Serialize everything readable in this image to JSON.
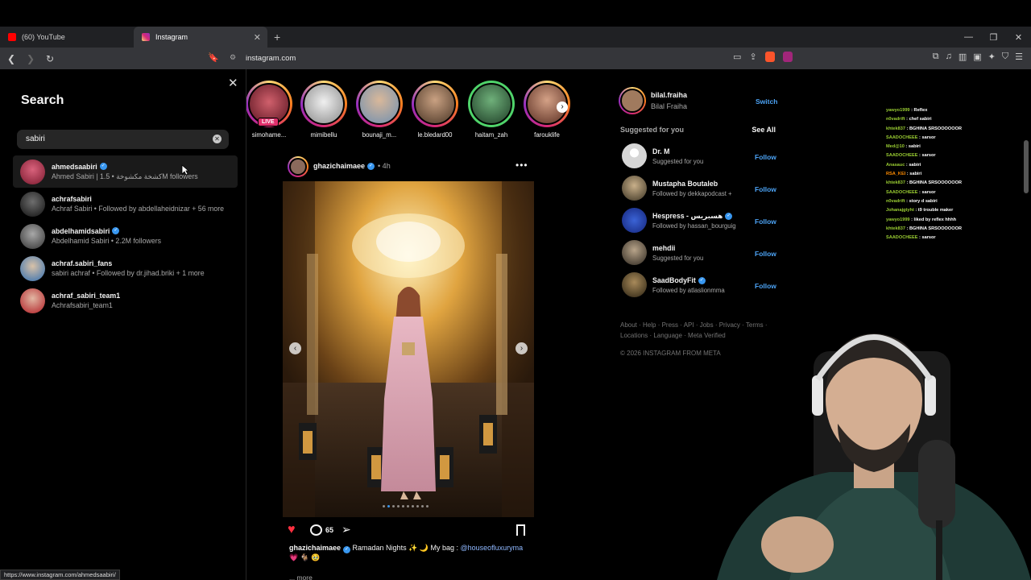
{
  "browser": {
    "tabs": [
      {
        "label": "(60) YouTube",
        "color": "#ff0000",
        "active": false
      },
      {
        "label": "Instagram",
        "color": "#d62976",
        "active": true
      }
    ],
    "url": "instagram.com",
    "status_url": "https://www.instagram.com/ahmedsaabiri/"
  },
  "search": {
    "title": "Search",
    "query": "sabiri",
    "results": [
      {
        "username": "ahmedsaabiri",
        "verified": true,
        "sub": "Ahmed Sabiri | 1.5 • كشخة مكشوخةM followers",
        "avatar_color": "#b2334b"
      },
      {
        "username": "achrafsabiri",
        "verified": false,
        "sub": "Achraf Sabiri • Followed by abdellaheidnizar + 56 more",
        "avatar_color": "#2b2b2b"
      },
      {
        "username": "abdelhamidsabiri",
        "verified": true,
        "sub": "Abdelhamid Sabiri • 2.2M followers",
        "avatar_color": "#5e5e5e"
      },
      {
        "username": "achraf.sabiri_fans",
        "verified": false,
        "sub": "sabiri achraf • Followed by dr.jihad.briki + 1 more",
        "avatar_color": "#3a7bbf"
      },
      {
        "username": "achraf_sabiri_team1",
        "verified": false,
        "sub": "Achrafsabiri_team1",
        "avatar_color": "#b01c24"
      }
    ]
  },
  "stories": [
    {
      "name": "simohame...",
      "live": true,
      "live_label": "LIVE",
      "color": "#9c2431",
      "ring": "gradient"
    },
    {
      "name": "mimibellu",
      "live": false,
      "color": "#d9d9d9",
      "ring": "gradient"
    },
    {
      "name": "bounaji_m...",
      "live": false,
      "color": "#6f8fb0",
      "ring": "gradient"
    },
    {
      "name": "le.bledard00",
      "live": false,
      "color": "#8c6e52",
      "ring": "gradient"
    },
    {
      "name": "haitam_zah",
      "live": false,
      "color": "#2f5d3a",
      "ring": "green"
    },
    {
      "name": "farouklife",
      "live": false,
      "color": "#7a4a3a",
      "ring": "gradient"
    }
  ],
  "post": {
    "username": "ghazichaimaee",
    "verified": true,
    "time": "• 4h",
    "comments": "65",
    "caption_user": "ghazichaimaee",
    "caption_text": " Ramadan Nights ✨ 🌙  My bag : ",
    "caption_link": "@houseofluxuryma",
    "caption_emoji": "💗 🐐 🥹",
    "more": "... more",
    "carousel": {
      "slides": 10,
      "current": 1
    }
  },
  "sidebar": {
    "me": {
      "username": "bilal.fraiha",
      "full_name": "Bilal Fraiha",
      "switch_label": "Switch"
    },
    "suggested_title": "Suggested for you",
    "see_all": "See All",
    "suggestions": [
      {
        "username": "Dr. M",
        "verified": false,
        "sub": "Suggested for you",
        "avatar_color": "#d6d6d6"
      },
      {
        "username": "Mustapha Boutaleb",
        "verified": false,
        "sub": "Followed by dekkapodcast +",
        "avatar_color": "#7a6a4e"
      },
      {
        "username": "Hespress - هسبريس",
        "verified": true,
        "sub": "Followed by hassan_bourguig",
        "avatar_color": "#1c3fa8"
      },
      {
        "username": "mehdii",
        "verified": false,
        "sub": "Suggested for you",
        "avatar_color": "#6b5f4f"
      },
      {
        "username": "SaadBodyFit",
        "verified": true,
        "sub": "Followed by atlaslionmma",
        "avatar_color": "#5a4a2e"
      }
    ],
    "follow_label": "Follow",
    "footer": "About · Help · Press · API · Jobs · Privacy · Terms · Locations · Language · Meta Verified",
    "copyright": "© 2026 INSTAGRAM FROM META"
  },
  "chat": [
    {
      "user": "yawyo1999",
      "msg": "Reflex",
      "color": "#9acd32"
    },
    {
      "user": "n0vadrift",
      "msg": "chef sabiri",
      "color": "#9acd32"
    },
    {
      "user": "khtek837",
      "msg": "BGHINA SRSOOOOOOR",
      "color": "#9acd32"
    },
    {
      "user": "SAADOCHEEE",
      "msg": "sarsor",
      "color": "#9acd32"
    },
    {
      "user": "Med@10",
      "msg": "sabiri",
      "color": "#9acd32"
    },
    {
      "user": "SAADOCHEEE",
      "msg": "sarsor",
      "color": "#9acd32"
    },
    {
      "user": "Anasauc",
      "msg": "sabiri",
      "color": "#9acd32"
    },
    {
      "user": "RSA_KEI",
      "msg": "sabiri",
      "color": "#ff8c00"
    },
    {
      "user": "khtek837",
      "msg": "BGHINA SRSOOOOOOR",
      "color": "#9acd32"
    },
    {
      "user": "SAADOCHEEE",
      "msg": "sarsor",
      "color": "#9acd32"
    },
    {
      "user": "n0vadrift",
      "msg": "story d sabiri",
      "color": "#9acd32"
    },
    {
      "user": "Johanajgtyht",
      "msg": "t9 trouble maker",
      "color": "#9acd32"
    },
    {
      "user": "yawyo1999",
      "msg": "liked by reflex hhhh",
      "color": "#9acd32"
    },
    {
      "user": "khtek837",
      "msg": "BGHINA SRSOOOOOOR",
      "color": "#9acd32"
    },
    {
      "user": "SAADOCHEEE",
      "msg": "sarsor",
      "color": "#9acd32"
    }
  ]
}
